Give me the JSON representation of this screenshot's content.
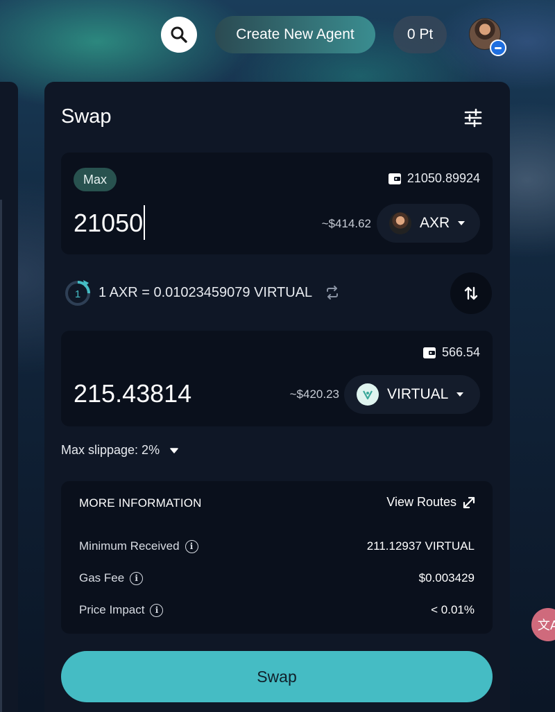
{
  "header": {
    "create_agent_label": "Create New Agent",
    "points_label": "0 Pt"
  },
  "swap": {
    "title": "Swap",
    "from": {
      "max_label": "Max",
      "balance": "21050.89924",
      "amount": "21050",
      "usd_value": "~$414.62",
      "token": "AXR"
    },
    "rate_text": "1 AXR = 0.01023459079 VIRTUAL",
    "refresh_countdown": "1",
    "to": {
      "balance": "566.54",
      "amount": "215.43814",
      "usd_value": "~$420.23",
      "token": "VIRTUAL"
    },
    "slippage_label": "Max slippage: 2%",
    "info": {
      "title": "MORE INFORMATION",
      "view_routes_label": "View Routes",
      "rows": [
        {
          "label": "Minimum Received",
          "value": "211.12937 VIRTUAL"
        },
        {
          "label": "Gas Fee",
          "value": "$0.003429"
        },
        {
          "label": "Price Impact",
          "value": "< 0.01%"
        }
      ]
    },
    "submit_label": "Swap"
  },
  "colors": {
    "accent": "#45bcc4",
    "card_bg": "#0f1726",
    "box_bg": "#0a101c",
    "max_chip": "#28524f"
  },
  "icons": {
    "search": "search-icon",
    "settings": "sliders-icon",
    "wallet": "wallet-icon",
    "swap_direction": "arrows-up-down-icon",
    "rate_invert": "repeat-icon",
    "expand": "expand-arrow-icon",
    "info": "info-icon",
    "translate": "translate-icon"
  },
  "translate_glyph": "文A"
}
